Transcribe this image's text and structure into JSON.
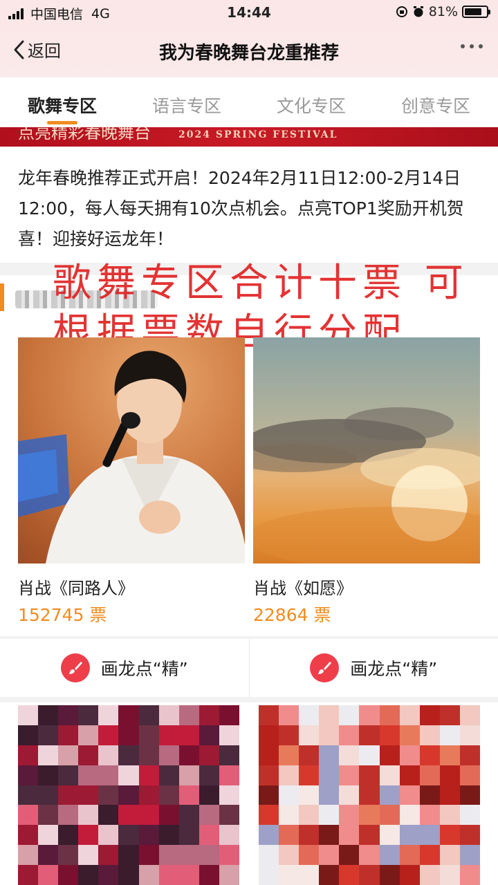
{
  "status_bar": {
    "carrier": "中国电信",
    "network": "4G",
    "time": "14:44",
    "battery": "81%",
    "battery_level": 0.81
  },
  "nav": {
    "back_label": "返回",
    "title": "我为春晚舞台龙重推荐"
  },
  "tabs": [
    {
      "label": "歌舞专区",
      "active": true
    },
    {
      "label": "语言专区",
      "active": false
    },
    {
      "label": "文化专区",
      "active": false
    },
    {
      "label": "创意专区",
      "active": false
    }
  ],
  "banner": {
    "text": "点亮精彩春晚舞台",
    "english": "2024 SPRING FESTIVAL"
  },
  "intro": "龙年春晚推荐正式开启！2024年2月11日12:00-2月14日12:00，每人每天拥有10次点机会。点亮TOP1奖励开机贺喜！迎接好运龙年！",
  "overlay_text": "歌舞专区合计十票 可根据票数自行分配",
  "cards": [
    {
      "title": "肖战《同路人》",
      "votes": "152745 票"
    },
    {
      "title": "肖战《如愿》",
      "votes": "22864 票"
    }
  ],
  "actions": [
    {
      "label": "画龙点“精”",
      "icon": "brush-icon"
    },
    {
      "label": "画龙点“精”",
      "icon": "brush-icon"
    }
  ],
  "colors": {
    "accent": "#f08c1e",
    "banner_red": "#b0101c",
    "overlay_red": "#e01818",
    "brush_red": "#ee3e4a"
  }
}
